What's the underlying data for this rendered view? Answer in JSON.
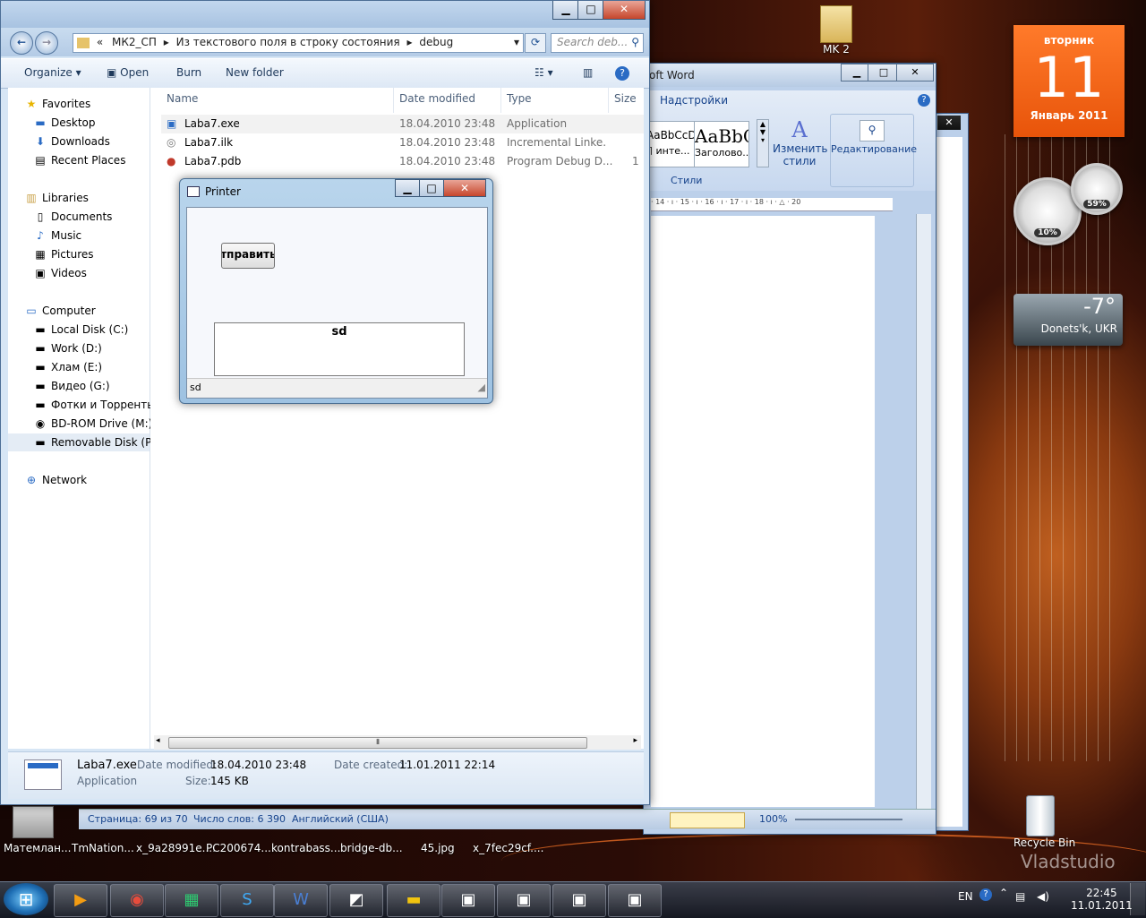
{
  "desktop": {
    "top_icon_label": "MK 2",
    "thumb_labels": [
      "Матемлан...",
      "TmNation...",
      "x_9a28991e....",
      "PC200674....",
      "kontrabass...",
      "bridge-db...",
      "45.jpg",
      "x_7fec29cf...."
    ],
    "recycle_label": "Recycle Bin",
    "watermark": "Vladstudio"
  },
  "calendar": {
    "weekday": "вторник",
    "day": "11",
    "month_year": "Январь 2011"
  },
  "gauges": {
    "cpu": "10%",
    "ram": "59%"
  },
  "weather": {
    "temp": "-7°",
    "city": "Donets'k, UKR"
  },
  "word": {
    "title": "oft Word",
    "ribbon_tab": "Надстройки",
    "style1_sample": "AaBbCcDc",
    "style1_name": "¶ инте...",
    "style2_sample": "AaBbC",
    "style2_name": "Заголово...",
    "change_styles": "Изменить стили",
    "editing": "Редактирование",
    "styles_group": "Стили",
    "ruler_text": "· 14 · ı · 15 · ı · 16 · ı · 17 · ı · 18 · ı · △ · 20",
    "status_page": "Страница: 69 из 70",
    "status_words": "Число слов: 6 390",
    "status_lang": "Английский (США)",
    "zoom": "100%"
  },
  "explorer": {
    "address": [
      "«",
      "МК2_СП",
      "Из текстового поля в строку состояния",
      "debug"
    ],
    "search_placeholder": "Search deb...",
    "toolbar": {
      "organize": "Organize ▾",
      "open": "Open",
      "burn": "Burn",
      "new_folder": "New folder"
    },
    "nav": {
      "favorites": "Favorites",
      "desktop": "Desktop",
      "downloads": "Downloads",
      "recent": "Recent Places",
      "libraries": "Libraries",
      "documents": "Documents",
      "music": "Music",
      "pictures": "Pictures",
      "videos": "Videos",
      "computer": "Computer",
      "c": "Local Disk (C:)",
      "d": "Work (D:)",
      "e": "Хлам (E:)",
      "g": "Видео (G:)",
      "photos": "Фотки и Торренты",
      "bd": "BD-ROM Drive (M:)",
      "p": "Removable Disk (P:)",
      "network": "Network"
    },
    "columns": {
      "name": "Name",
      "date": "Date modified",
      "type": "Type",
      "size": "Size"
    },
    "files": [
      {
        "name": "Laba7.exe",
        "date": "18.04.2010 23:48",
        "type": "Application",
        "size": ""
      },
      {
        "name": "Laba7.ilk",
        "date": "18.04.2010 23:48",
        "type": "Incremental Linke...",
        "size": ""
      },
      {
        "name": "Laba7.pdb",
        "date": "18.04.2010 23:48",
        "type": "Program Debug D...",
        "size": "1"
      }
    ],
    "details": {
      "name": "Laba7.exe",
      "kind": "Application",
      "modified_label": "Date modified:",
      "modified": "18.04.2010 23:48",
      "created_label": "Date created:",
      "created": "11.01.2011 22:14",
      "size_label": "Size:",
      "size": "145 KB"
    }
  },
  "printer": {
    "title": "Printer",
    "button": "Отправить",
    "box_text": "sd",
    "status": "sd"
  },
  "taskbar": {
    "lang": "EN",
    "time": "22:45",
    "date": "11.01.2011"
  }
}
